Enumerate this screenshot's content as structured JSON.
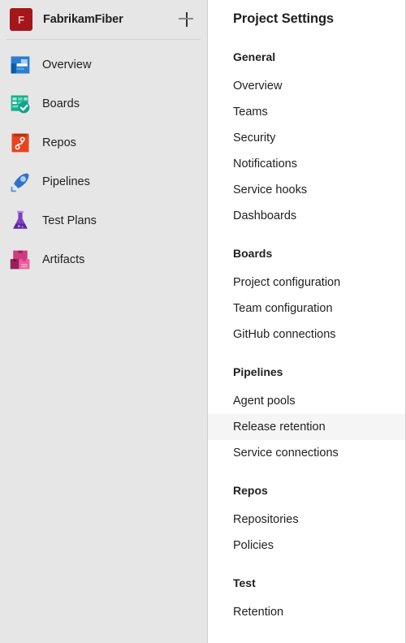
{
  "sidebar": {
    "project": {
      "initial": "F",
      "name": "FabrikamFiber",
      "avatar_color": "#a4161a",
      "add_label": "+"
    },
    "items": [
      {
        "label": "Overview",
        "icon": "overview-icon",
        "color": "#2a7cd5"
      },
      {
        "label": "Boards",
        "icon": "boards-icon",
        "color": "#1aaf8e"
      },
      {
        "label": "Repos",
        "icon": "repos-icon",
        "color": "#e8431f"
      },
      {
        "label": "Pipelines",
        "icon": "pipelines-icon",
        "color": "#2f71cd"
      },
      {
        "label": "Test Plans",
        "icon": "test-plans-icon",
        "color": "#7d3fc4"
      },
      {
        "label": "Artifacts",
        "icon": "artifacts-icon",
        "color": "#cf3b7e"
      }
    ]
  },
  "settings": {
    "title": "Project Settings",
    "groups": [
      {
        "heading": "General",
        "items": [
          "Overview",
          "Teams",
          "Security",
          "Notifications",
          "Service hooks",
          "Dashboards"
        ]
      },
      {
        "heading": "Boards",
        "items": [
          "Project configuration",
          "Team configuration",
          "GitHub connections"
        ]
      },
      {
        "heading": "Pipelines",
        "items": [
          "Agent pools",
          "Release retention",
          "Service connections"
        ]
      },
      {
        "heading": "Repos",
        "items": [
          "Repositories",
          "Policies"
        ]
      },
      {
        "heading": "Test",
        "items": [
          "Retention"
        ]
      }
    ],
    "active_item": "Release retention",
    "active_highlight_color": "#f5f5f5"
  }
}
